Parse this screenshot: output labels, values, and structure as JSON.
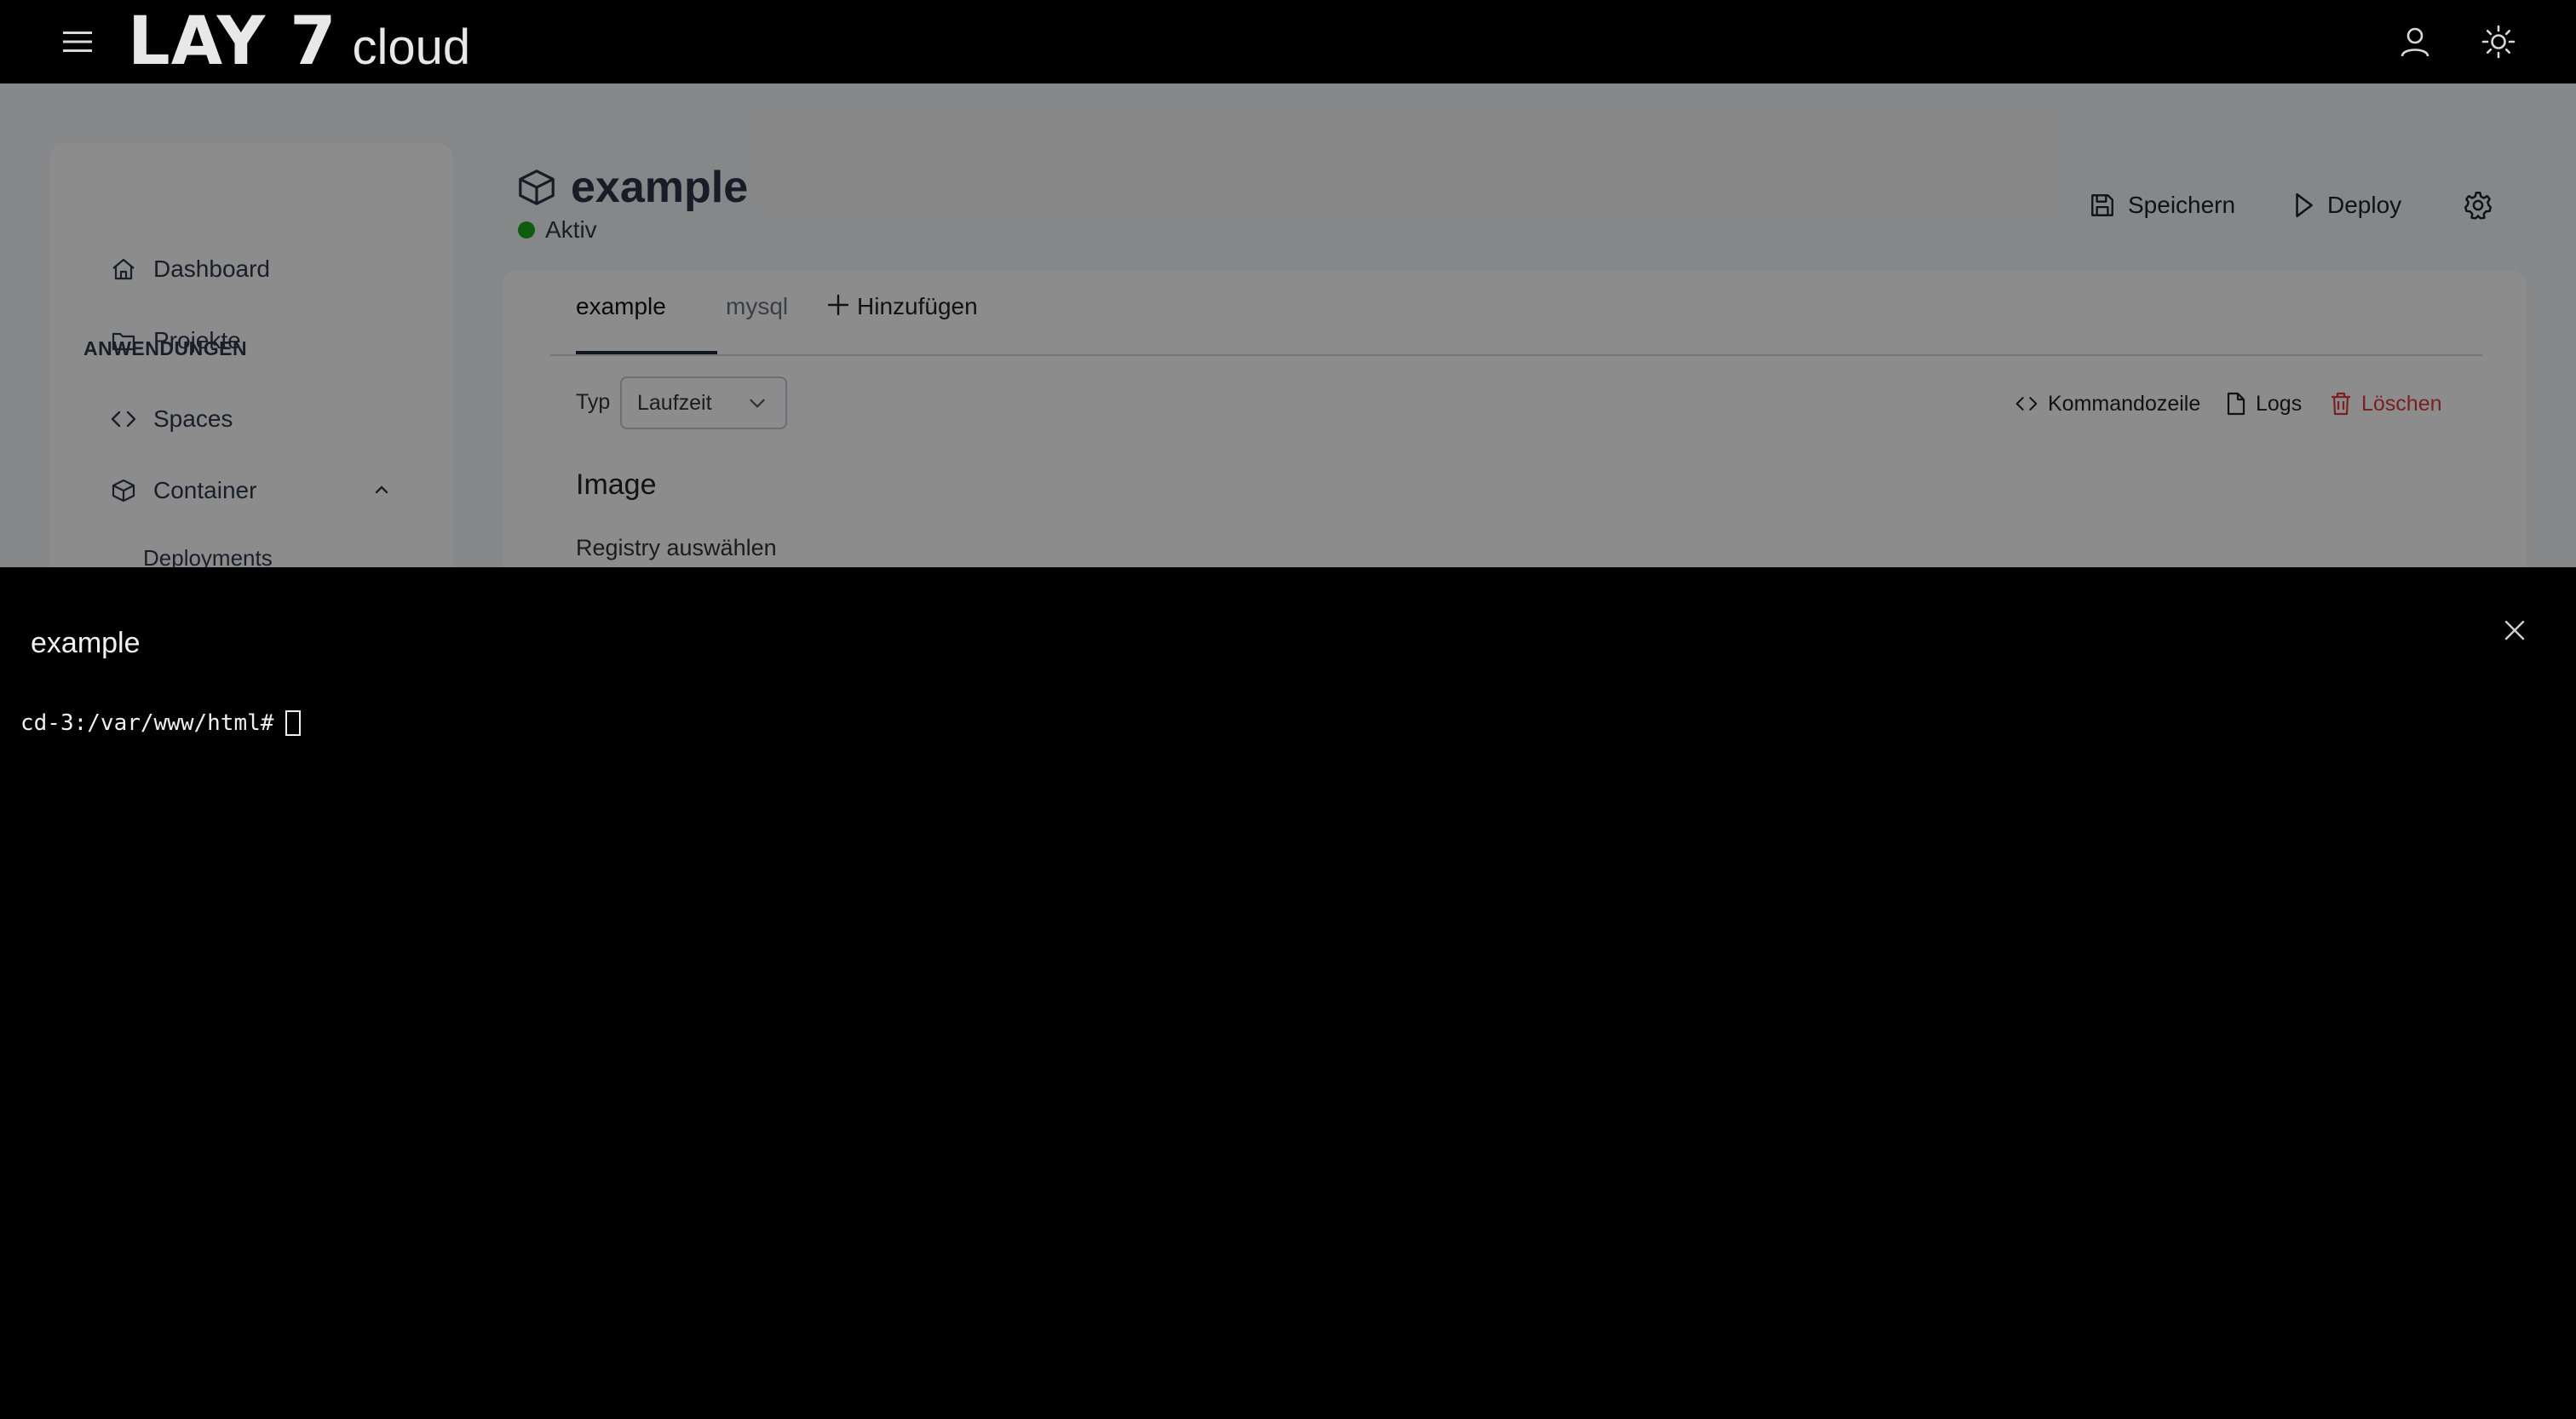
{
  "header": {
    "logo_main": "LAY 7",
    "logo_sub": "cloud",
    "icons": [
      "menu-icon",
      "user-icon",
      "sun-icon"
    ]
  },
  "sidebar": {
    "items": [
      {
        "label": "Dashboard",
        "icon": "home-icon"
      },
      {
        "label": "Projekte",
        "icon": "folder-icon"
      }
    ],
    "section_label": "ANWENDUNGEN",
    "app_items": [
      {
        "label": "Spaces",
        "icon": "code-icon"
      },
      {
        "label": "Container",
        "icon": "cube-icon",
        "expanded": true
      }
    ],
    "sub_items": [
      {
        "label": "Deployments"
      }
    ]
  },
  "page": {
    "title": "example",
    "status": "Aktiv",
    "status_color": "#1aa81a",
    "actions": {
      "save": "Speichern",
      "deploy": "Deploy"
    }
  },
  "tabs": {
    "items": [
      {
        "label": "example",
        "active": true
      },
      {
        "label": "mysql",
        "active": false
      }
    ],
    "add_label": "Hinzufügen"
  },
  "container": {
    "type_label": "Typ",
    "type_value": "Laufzeit",
    "actions": {
      "shell": "Kommandozeile",
      "logs": "Logs",
      "delete": "Löschen"
    },
    "delete_color": "#e03a3a",
    "section_title": "Image",
    "section_subtitle": "Registry auswählen"
  },
  "terminal": {
    "title": "example",
    "prompt": "cd-3:/var/www/html#"
  }
}
